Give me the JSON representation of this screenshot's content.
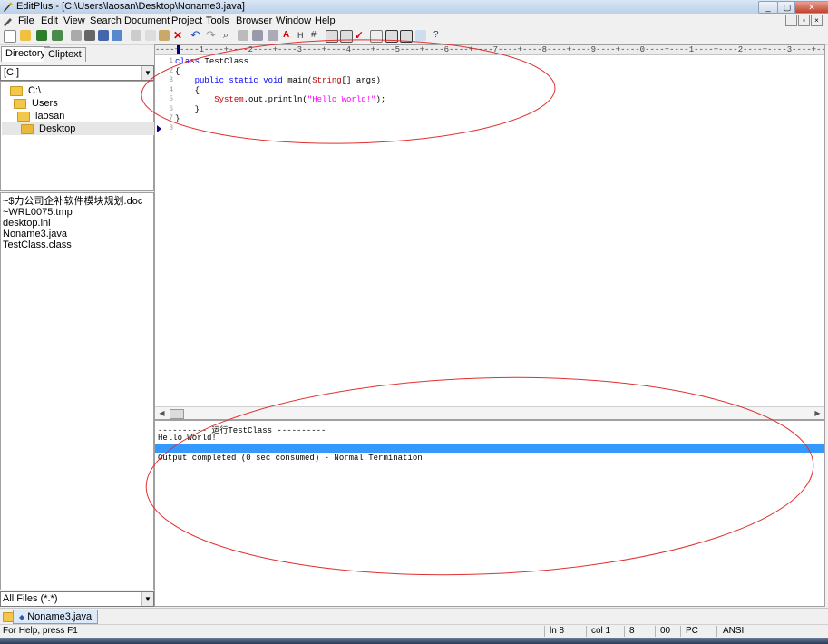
{
  "window": {
    "title": "EditPlus - [C:\\Users\\laosan\\Desktop\\Noname3.java]"
  },
  "menu": [
    "File",
    "Edit",
    "View",
    "Search",
    "Document",
    "Project",
    "Tools",
    "Browser",
    "Window",
    "Help"
  ],
  "panel": {
    "tabs": [
      "Directory",
      "Cliptext"
    ],
    "drive": "[C:]",
    "tree": [
      "C:\\",
      "Users",
      "laosan",
      "Desktop"
    ],
    "files": [
      "~$力公司企补软件模块规划.doc",
      "~WRL0075.tmp",
      "desktop.ini",
      "Noname3.java",
      "TestClass.class"
    ],
    "filter": "All Files (*.*)"
  },
  "editor": {
    "ruler": "----+----1----+----2----+----3----+----4----+----5----+----6----+----7----+----8----+----9----+----0----+----1----+----2----+----3----+----4-",
    "lines": [
      {
        "n": "1",
        "indent": "",
        "parts": [
          {
            "t": "class",
            "c": "kw"
          },
          {
            "t": " TestClass",
            "c": ""
          }
        ]
      },
      {
        "n": "2",
        "indent": "",
        "parts": [
          {
            "t": "{",
            "c": ""
          }
        ]
      },
      {
        "n": "3",
        "indent": "    ",
        "parts": [
          {
            "t": "public",
            "c": "kw"
          },
          {
            "t": " ",
            "c": ""
          },
          {
            "t": "static",
            "c": "kw"
          },
          {
            "t": " ",
            "c": ""
          },
          {
            "t": "void",
            "c": "kw"
          },
          {
            "t": " main(",
            "c": ""
          },
          {
            "t": "String",
            "c": "ty"
          },
          {
            "t": "[] args)",
            "c": ""
          }
        ]
      },
      {
        "n": "4",
        "indent": "    ",
        "parts": [
          {
            "t": "{",
            "c": ""
          }
        ]
      },
      {
        "n": "5",
        "indent": "        ",
        "parts": [
          {
            "t": "System",
            "c": "cls"
          },
          {
            "t": ".out.println(",
            "c": ""
          },
          {
            "t": "\"Hello World!\"",
            "c": "str"
          },
          {
            "t": ");",
            "c": ""
          }
        ]
      },
      {
        "n": "6",
        "indent": "    ",
        "parts": [
          {
            "t": "}",
            "c": ""
          }
        ]
      },
      {
        "n": "7",
        "indent": "",
        "parts": [
          {
            "t": "}",
            "c": ""
          }
        ]
      },
      {
        "n": "8",
        "indent": "",
        "parts": []
      }
    ]
  },
  "output": {
    "lines": [
      "---------- 运行TestClass ----------",
      "Hello World!",
      "",
      "Output completed (0 sec consumed) - Normal Termination"
    ]
  },
  "doctab": "Noname3.java",
  "status": {
    "help": "For Help, press F1",
    "ln": "ln 8",
    "col": "col 1",
    "n": "8",
    "code": "00",
    "mode": "PC",
    "enc": "ANSI"
  },
  "colors": {
    "annotation": "#e03030",
    "selection": "#3399ff",
    "keyword": "#0000ff",
    "string": "#ff00ff"
  }
}
